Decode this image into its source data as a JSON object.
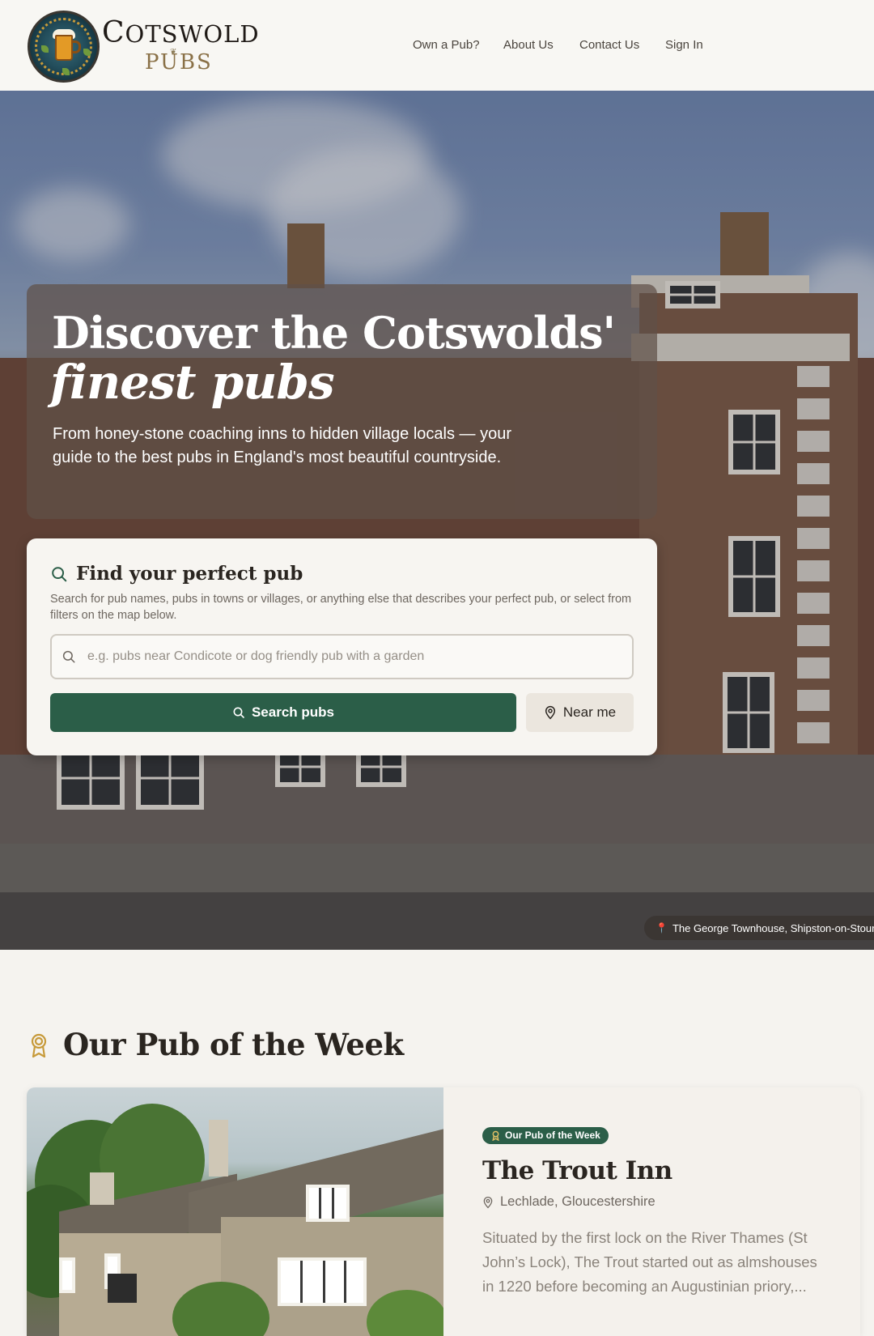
{
  "brand": {
    "line1_cap": "C",
    "line1_rest": "OTSWOLD",
    "line2": "PUBS",
    "logo_icon": "beer-mug-stained-glass-logo"
  },
  "nav": {
    "items": [
      {
        "label": "Own a Pub?"
      },
      {
        "label": "About Us"
      },
      {
        "label": "Contact Us"
      },
      {
        "label": "Sign In"
      }
    ]
  },
  "hero": {
    "title_line1": "Discover the Cotswolds'",
    "title_line2": "finest pubs",
    "subtitle": "From honey-stone coaching inns to hidden village locals — your guide to the best pubs in England's most beautiful countryside.",
    "photo_caption": "The George Townhouse, Shipston-on-Stour",
    "caption_icon": "pin-icon"
  },
  "search": {
    "title": "Find your perfect pub",
    "help": "Search for pub names, pubs in towns or villages, or anything else that describes your perfect pub, or select from filters on the map below.",
    "placeholder": "e.g. pubs near Condicote or dog friendly pub with a garden",
    "value": "",
    "search_button": "Search pubs",
    "near_button": "Near me"
  },
  "pub_of_week": {
    "heading": "Our Pub of the Week",
    "badge": "Our Pub of the Week",
    "name": "The Trout Inn",
    "location": "Lechlade, Gloucestershire",
    "description": "Situated by the first lock on the River Thames (St John’s Lock), The Trout started out as almshouses in 1220 before becoming an Augustinian priory,..."
  },
  "colors": {
    "primary_green": "#2b5e48",
    "accent_gold": "#c79a3a",
    "page_bg": "#f5f3ef",
    "header_bg": "#f8f7f3"
  }
}
